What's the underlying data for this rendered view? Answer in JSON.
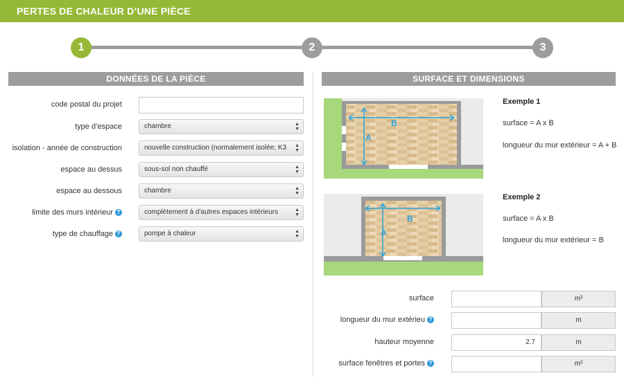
{
  "header": {
    "title": "PERTES DE CHALEUR D’UNE PIÈCE"
  },
  "stepper": {
    "steps": [
      "1",
      "2",
      "3"
    ],
    "active_step": 1
  },
  "left": {
    "section_title": "DONNÉES DE LA PIÈCE",
    "fields": [
      {
        "label": "code postal du projet",
        "value": ""
      },
      {
        "label": "type d’espace",
        "value": "chambre"
      },
      {
        "label": "isolation - année de construction",
        "value": "nouvelle construction (normalement isolée; K3"
      },
      {
        "label": "espace au dessus",
        "value": "sous-sol non chauffé"
      },
      {
        "label": "espace au dessous",
        "value": "chambre"
      },
      {
        "label": "limite des murs intérieur",
        "value": "complètement à d'autres espaces intérieurs"
      },
      {
        "label": "type de chauffage",
        "value": "pompe à chaleur"
      }
    ]
  },
  "right": {
    "section_title": "SURFACE ET DIMENSIONS",
    "examples": [
      {
        "title": "Exemple 1",
        "surface": "surface = A x B",
        "wall": "longueur du mur extérieur = A + B",
        "label_a": "A",
        "label_b": "B"
      },
      {
        "title": "Exemple 2",
        "surface": "surface = A x B",
        "wall": "longueur du mur extérieur = B",
        "label_a": "A",
        "label_b": "B"
      }
    ],
    "dimensions": [
      {
        "label": "surface",
        "value": "",
        "unit": "m²"
      },
      {
        "label": "longueur du mur extérieu",
        "value": "",
        "unit": "m"
      },
      {
        "label": "hauteur moyenne",
        "value": "2.7",
        "unit": "m"
      },
      {
        "label": "surface fenêtres et portes",
        "value": "",
        "unit": "m²"
      }
    ]
  },
  "help_glyph": "?",
  "colors": {
    "brand_green": "#95b836",
    "header_gray": "#9d9d9d",
    "help_blue": "#2f9ad8",
    "dimension_blue": "#29a3dc"
  }
}
